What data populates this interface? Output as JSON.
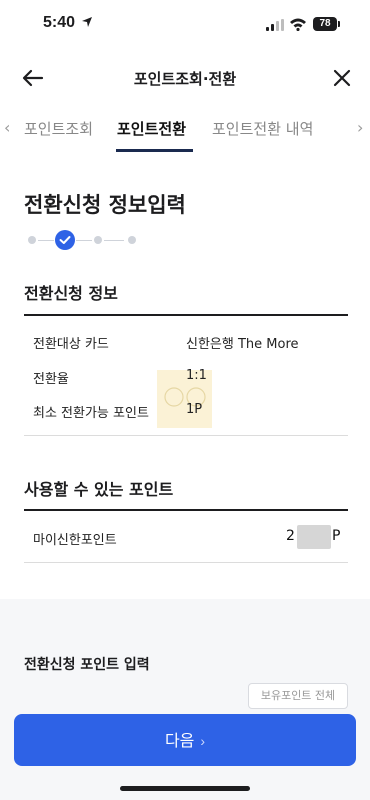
{
  "status_bar": {
    "time": "5:40",
    "battery": "78"
  },
  "header": {
    "title": "포인트조회·전환"
  },
  "tabs": [
    {
      "label": "포인트조회",
      "active": false
    },
    {
      "label": "포인트전환",
      "active": true
    },
    {
      "label": "포인트전환 내역",
      "active": false
    }
  ],
  "form": {
    "title": "전환신청 정보입력",
    "steps": {
      "current": 2
    }
  },
  "info_section": {
    "title": "전환신청 정보",
    "rows": [
      {
        "label": "전환대상 카드",
        "value": "신한은행 The More"
      },
      {
        "label": "전환율",
        "value": "1:1"
      },
      {
        "label": "최소 전환가능 포인트",
        "value": "1P"
      }
    ]
  },
  "available_section": {
    "title": "사용할 수 있는 포인트",
    "item_label": "마이신한포인트",
    "item_value_prefix": "2",
    "item_value_unit": "P"
  },
  "input_section": {
    "title": "전환신청 포인트 입력",
    "all_points_button": "보유포인트 전체"
  },
  "footer": {
    "next_label": "다음",
    "next_chevron": "›"
  },
  "colors": {
    "accent": "#2e62e6",
    "tab_underline": "#1a2a4f"
  }
}
